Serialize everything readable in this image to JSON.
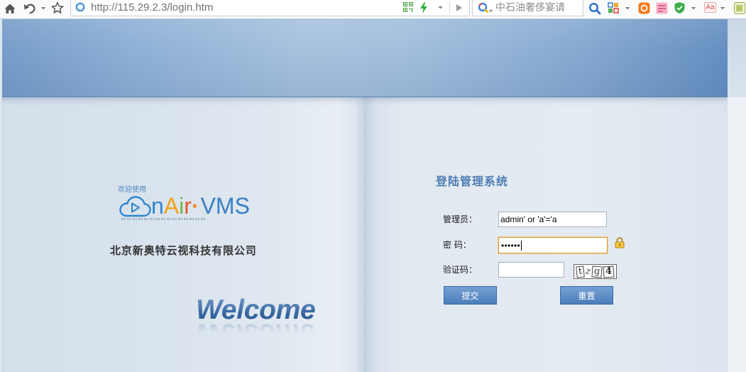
{
  "browser": {
    "url": "http://115.29.2.3/login.htm",
    "search": {
      "placeholder": "中石油奢侈宴请"
    },
    "aa_icon_label": "Aa",
    "toolbar_icons": [
      "home-icon",
      "undo-icon",
      "star-icon",
      "site-icon",
      "qr-code-icon",
      "lightning-icon",
      "play-icon",
      "search-engine-icon",
      "search-icon",
      "apps-icon",
      "orange-extension-icon",
      "pink-extension-icon",
      "security-shield-icon",
      "font-aa-icon",
      "extension-icon"
    ]
  },
  "page": {
    "colors": {
      "header_blue": "#8eb0d6",
      "brand_blue": "#3a7fc4",
      "title_blue": "#4e7db3",
      "button_blue": "#5a89c2",
      "focus_border": "#d89a3e"
    },
    "logo": {
      "welcome_use": "欢迎使用",
      "icon": "cloud-play-icon",
      "letters": [
        {
          "char": "n",
          "color": "#2f86cf"
        },
        {
          "char": "A",
          "color": "#f5a31a"
        },
        {
          "char": "i",
          "color": "#6dbb45"
        },
        {
          "char": "r",
          "color": "#e9542f"
        }
      ],
      "dot": {
        "char": "·",
        "color": "#f08a24"
      },
      "product": {
        "text": "VMS",
        "color": "#3a7fc4"
      }
    },
    "company_name": "北京新奥特云视科技有限公司",
    "welcome_text": "Welcome",
    "login": {
      "title": "登陆管理系统",
      "username": {
        "label": "管理员：",
        "value": "admin' or 'a'='a"
      },
      "password": {
        "label": "密 码：",
        "masked_value": "••••••"
      },
      "captcha": {
        "label": "验证码：",
        "image_chars": [
          "t",
          "z",
          "g",
          "4"
        ]
      },
      "lock_icon": "lock-icon",
      "submit_label": "提交",
      "reset_label": "重置"
    }
  }
}
